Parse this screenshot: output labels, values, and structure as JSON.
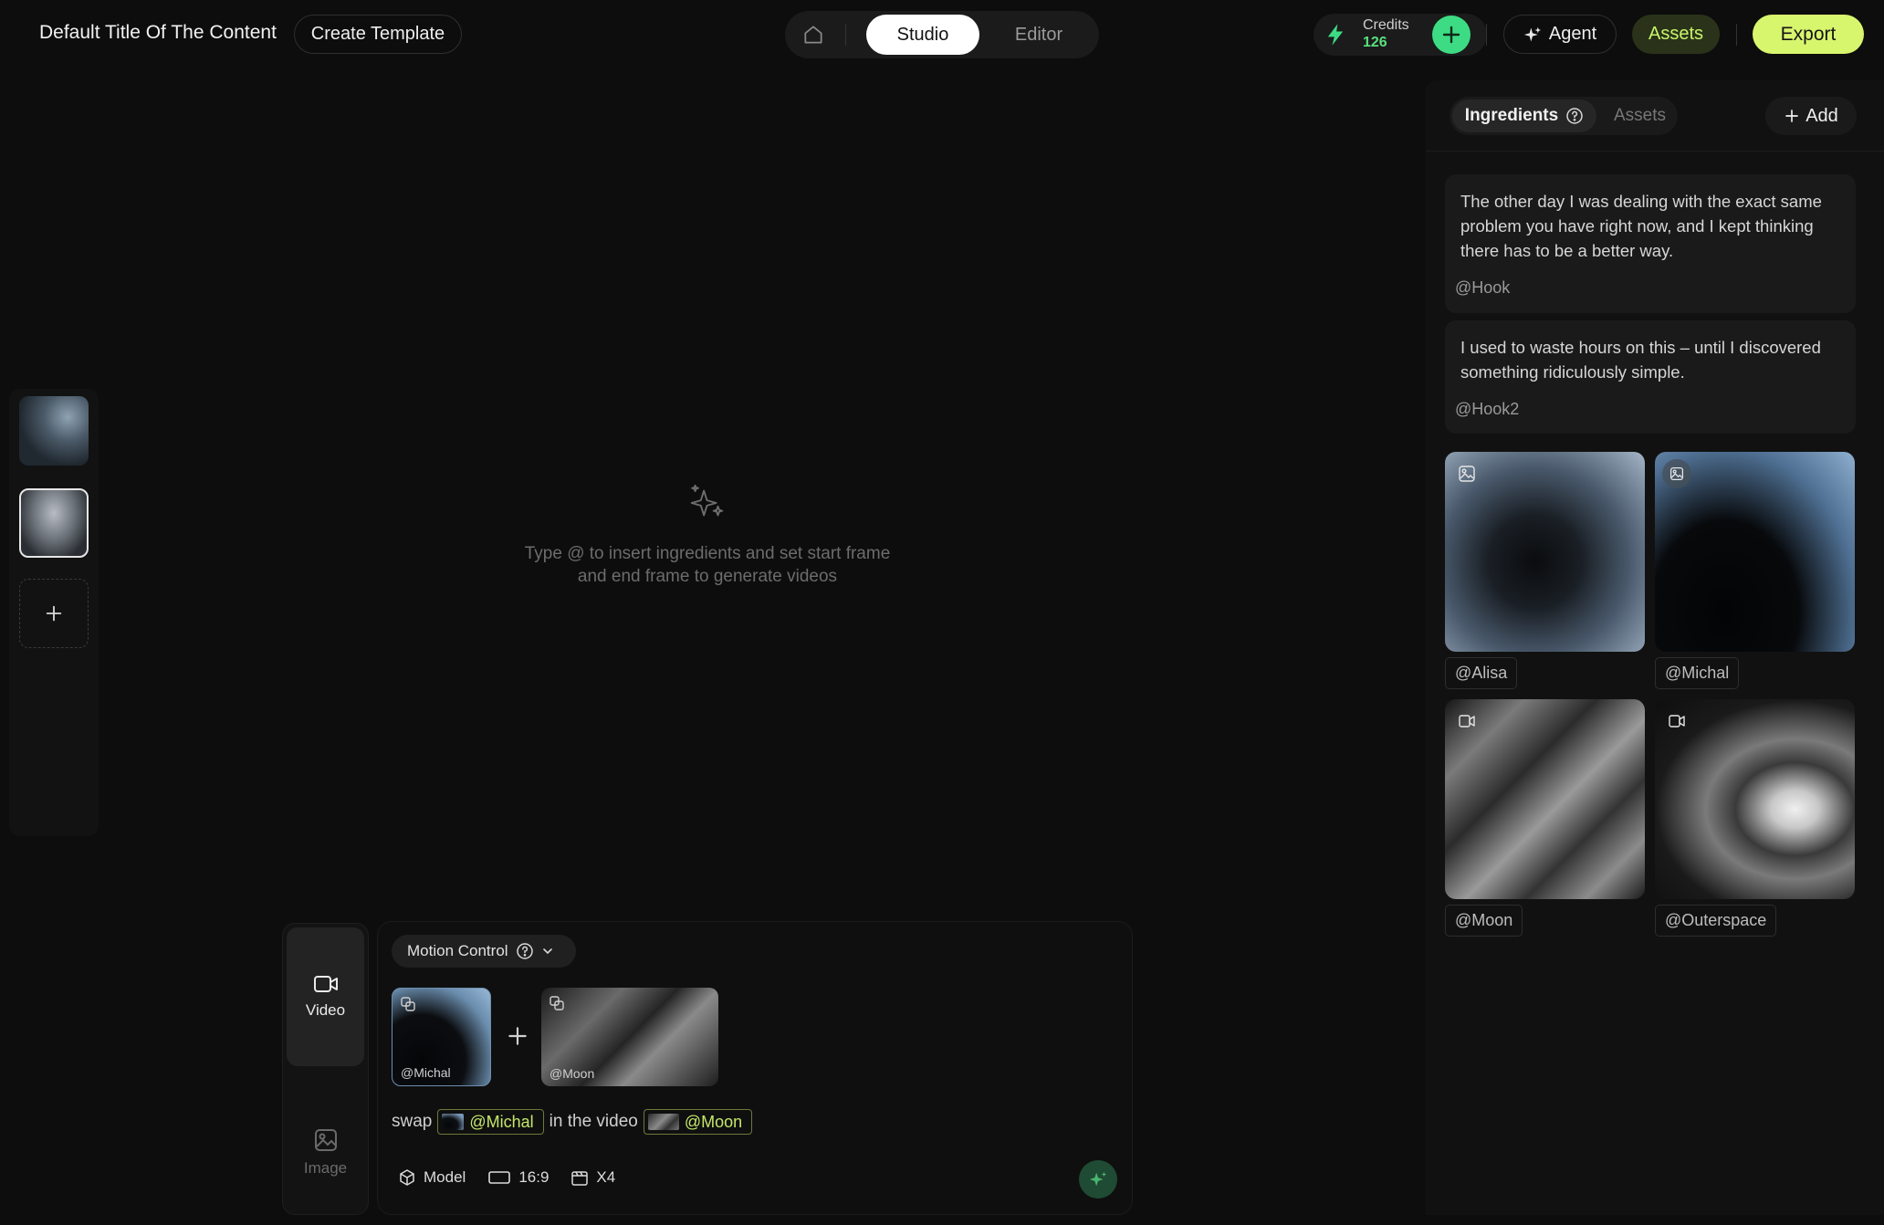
{
  "header": {
    "doc_title": "Default Title Of The Content",
    "create_template": "Create Template",
    "tabs": {
      "studio": "Studio",
      "editor": "Editor"
    },
    "credits_label": "Credits",
    "credits_value": "126",
    "agent": "Agent",
    "assets": "Assets",
    "export": "Export"
  },
  "empty_state": {
    "line1": "Type @ to insert ingredients and set start frame",
    "line2": "and end frame to generate videos"
  },
  "composer": {
    "side": {
      "video": "Video",
      "image": "Image"
    },
    "mode": "Motion Control",
    "refs": [
      {
        "tag": "@Michal"
      },
      {
        "tag": "@Moon"
      }
    ],
    "prompt": {
      "word1": "swap",
      "chip1": "@Michal",
      "word2": "in the video",
      "chip2": "@Moon"
    },
    "options": {
      "model": "Model",
      "ratio": "16:9",
      "count": "X4"
    }
  },
  "right_panel": {
    "tabs": {
      "ingredients": "Ingredients",
      "assets": "Assets"
    },
    "add": "Add",
    "text_cards": [
      {
        "text": "The other day I was dealing with the exact same problem you have right now, and I kept thinking there has to be a better way.",
        "tag": "@Hook"
      },
      {
        "text": "I used to waste hours on this – until I discovered something ridiculously simple.",
        "tag": "@Hook2"
      }
    ],
    "media": [
      {
        "tag": "@Alisa",
        "kind": "image"
      },
      {
        "tag": "@Michal",
        "kind": "image"
      },
      {
        "tag": "@Moon",
        "kind": "video"
      },
      {
        "tag": "@Outerspace",
        "kind": "video"
      }
    ]
  },
  "colors": {
    "accent_green": "#3ddc84",
    "export_lime": "#d8f56e",
    "chip_text": "#c5e86a"
  }
}
